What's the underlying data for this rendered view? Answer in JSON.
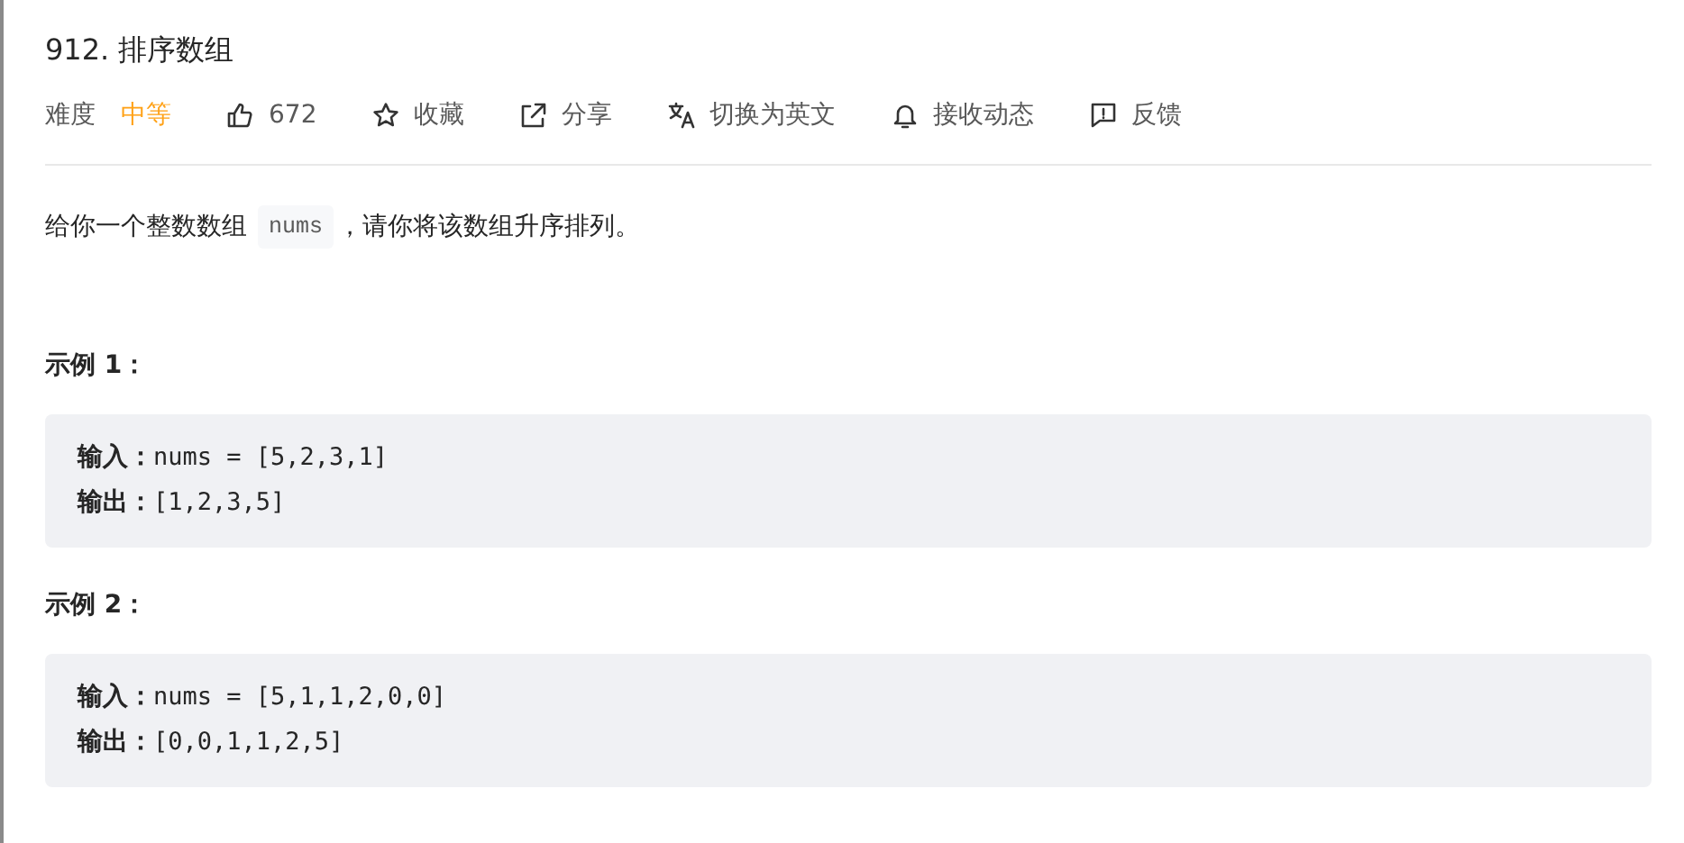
{
  "problem": {
    "title": "912. 排序数组"
  },
  "toolbar": [
    {
      "kind": "difficulty",
      "label": "难度",
      "value": "中等"
    },
    {
      "kind": "action",
      "label": "672"
    },
    {
      "kind": "action",
      "label": "收藏"
    },
    {
      "kind": "action",
      "label": "分享"
    },
    {
      "kind": "action",
      "label": "切换为英文"
    },
    {
      "kind": "action",
      "label": "接收动态"
    },
    {
      "kind": "action",
      "label": "反馈"
    }
  ],
  "description": {
    "before": "给你一个整数数组",
    "code": "nums",
    "after": "，请你将该数组升序排列。"
  },
  "examples": [
    {
      "heading": "示例 1：",
      "lines": [
        "**输入：**nums = [5,2,3,1]",
        "**输出：**[1,2,3,5]"
      ]
    },
    {
      "heading": "示例 2：",
      "lines": [
        "**输入：**nums = [5,1,1,2,0,0]",
        "**输出：**[0,0,1,1,2,5]"
      ]
    }
  ]
}
